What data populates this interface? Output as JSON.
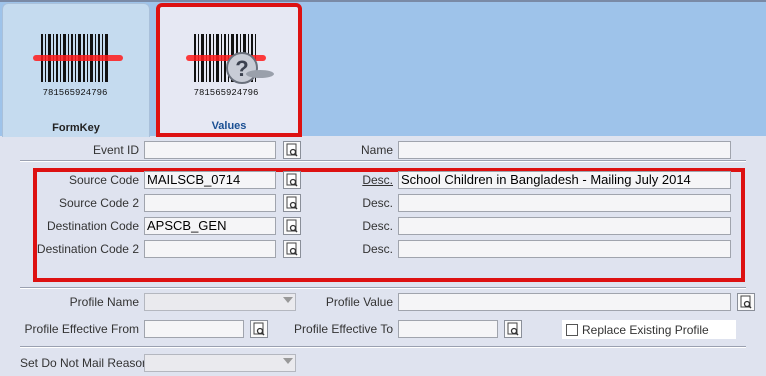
{
  "tabs": {
    "formkey_label": "FormKey",
    "values_label": "Values",
    "barcode_digits": "781565924796"
  },
  "fields": {
    "event_id_label": "Event ID",
    "event_id_value": "",
    "name_label": "Name",
    "name_value": "",
    "source_code_label": "Source Code",
    "source_code_value": "MAILSCB_0714",
    "source_desc_label": "Desc.",
    "source_desc_value": "School Children in Bangladesh - Mailing July 2014",
    "source_code2_label": "Source Code 2",
    "source_code2_value": "",
    "source_desc2_label": "Desc.",
    "source_desc2_value": "",
    "dest_code_label": "Destination Code",
    "dest_code_value": "APSCB_GEN",
    "dest_desc_label": "Desc.",
    "dest_desc_value": "",
    "dest_code2_label": "Destination Code 2",
    "dest_code2_value": "",
    "dest_desc2_label": "Desc.",
    "dest_desc2_value": "",
    "profile_name_label": "Profile Name",
    "profile_name_value": "",
    "profile_value_label": "Profile Value",
    "profile_value_value": "",
    "profile_eff_from_label": "Profile Effective From",
    "profile_eff_from_value": "",
    "profile_eff_to_label": "Profile Effective To",
    "profile_eff_to_value": "",
    "replace_profile_label": "Replace Existing Profile",
    "replace_profile_checked": false,
    "dnm_reason_label": "Set Do Not Mail Reason",
    "dnm_reason_value": ""
  },
  "colors": {
    "highlight": "#dd1111",
    "topbar": "#9ec3ea",
    "values_tab_text": "#1a4f93"
  },
  "icons": {
    "lookup": "lookup-icon",
    "barcode": "barcode-icon",
    "barcode_question": "barcode-question-icon"
  }
}
